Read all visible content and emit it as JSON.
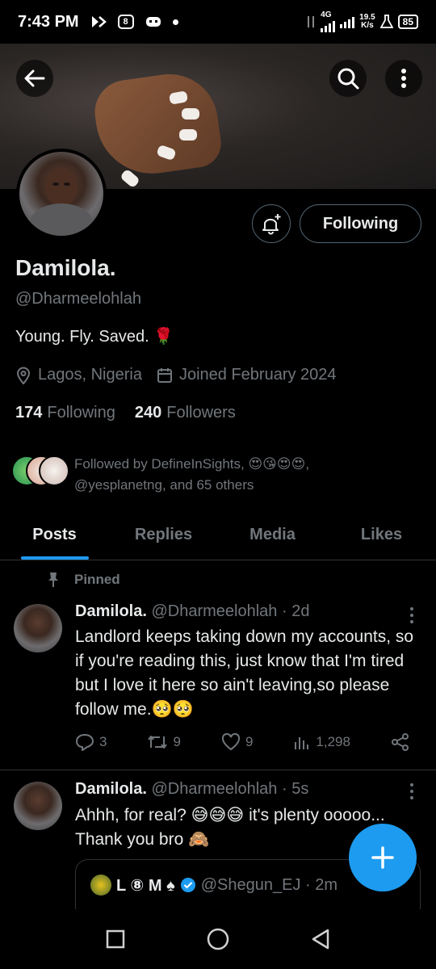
{
  "status_bar": {
    "time": "7:43 PM",
    "network": "4G",
    "speed_value": "19.5",
    "speed_unit": "K/s",
    "battery": "85"
  },
  "profile": {
    "name": "Damilola.",
    "handle": "@Dharmeelohlah",
    "bio": "Young. Fly. Saved. 🌹",
    "location": "Lagos, Nigeria",
    "joined": "Joined February 2024",
    "following_count": "174",
    "following_label": "Following",
    "followers_count": "240",
    "followers_label": "Followers",
    "follow_button_label": "Following",
    "followed_by_line1": "Followed by DefineInSights, 😍😘😍😍,",
    "followed_by_line2": "@yesplanetng, and 65 others"
  },
  "tabs": [
    {
      "label": "Posts"
    },
    {
      "label": "Replies"
    },
    {
      "label": "Media"
    },
    {
      "label": "Likes"
    }
  ],
  "pinned_label": "Pinned",
  "posts": [
    {
      "name": "Damilola.",
      "meta": "@Dharmeelohlah · 2d",
      "text": "Landlord keeps taking down my accounts, so if you're reading this, just know that I'm tired but I love it here so ain't leaving,so please follow me.🥺🥺",
      "replies": "3",
      "reposts": "9",
      "likes": "9",
      "views": "1,298"
    },
    {
      "name": "Damilola.",
      "meta": "@Dharmeelohlah · 5s",
      "text": "Ahhh, for real? 😅😅😅 it's plenty ooooo... Thank you bro 🙈",
      "quote_name": "L ⑧ M ♠",
      "quote_meta": "@Shegun_EJ · 2m"
    }
  ],
  "colors": {
    "accent": "#1d9bf0",
    "muted": "#71767b",
    "text": "#e7e9ea",
    "border": "#2f3336",
    "background": "#000000"
  }
}
